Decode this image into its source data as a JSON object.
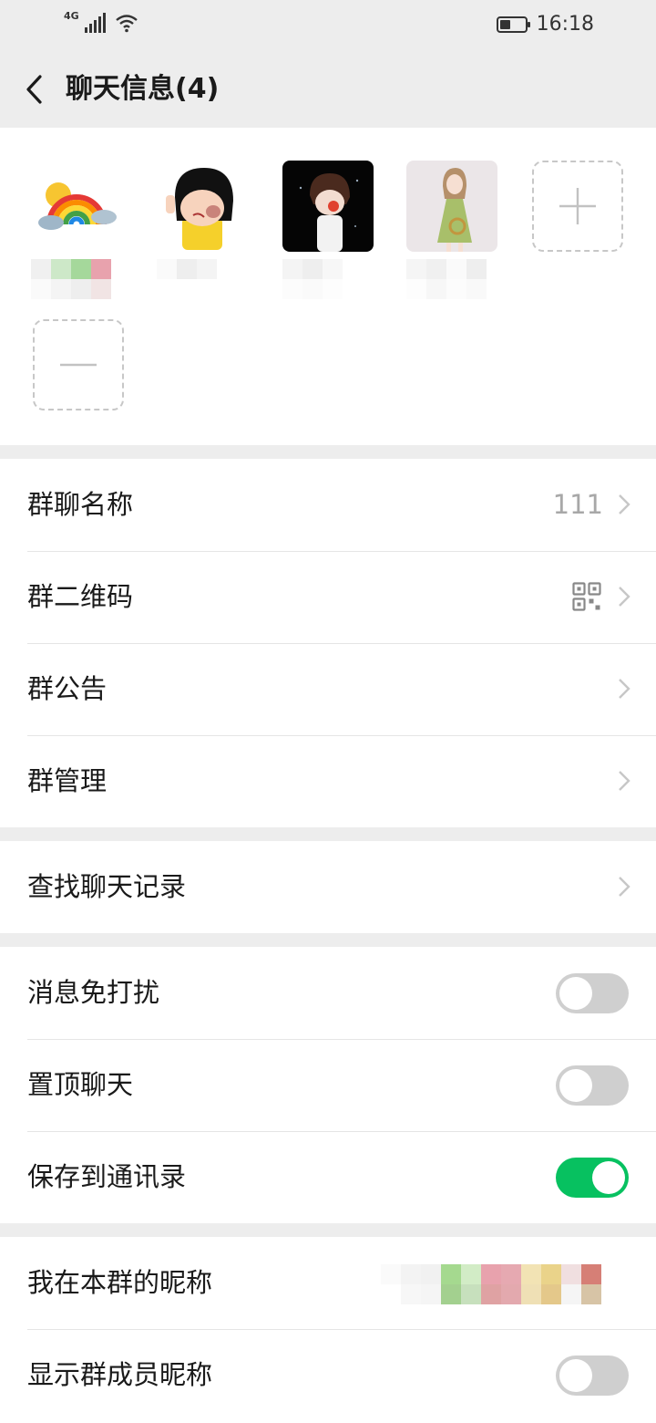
{
  "status_bar": {
    "network": "4G",
    "time": "16:18",
    "battery_level": 0.45
  },
  "header": {
    "title": "聊天信息(4)"
  },
  "members": {
    "count": 4,
    "avatar_icons": [
      "rainbow-avatar-icon",
      "girl-cartoon-avatar-icon",
      "boy-cartoon-avatar-icon",
      "girl-illustration-avatar-icon"
    ],
    "add_icon": "plus-icon",
    "remove_icon": "minus-icon"
  },
  "group_info": {
    "name_label": "群聊名称",
    "name_value": "111",
    "qrcode_label": "群二维码",
    "announcement_label": "群公告",
    "manage_label": "群管理"
  },
  "search": {
    "history_label": "查找聊天记录"
  },
  "settings": {
    "mute_label": "消息免打扰",
    "mute_on": false,
    "pin_label": "置顶聊天",
    "pin_on": false,
    "save_contacts_label": "保存到通讯录",
    "save_contacts_on": true
  },
  "nickname": {
    "my_nickname_label": "我在本群的昵称",
    "show_nicknames_label": "显示群成员昵称",
    "show_nicknames_on": false
  },
  "colors": {
    "accent": "#07c160",
    "toggle_off": "#cfcfcf",
    "background": "#ededed",
    "secondary_text": "#a8a8a8"
  }
}
